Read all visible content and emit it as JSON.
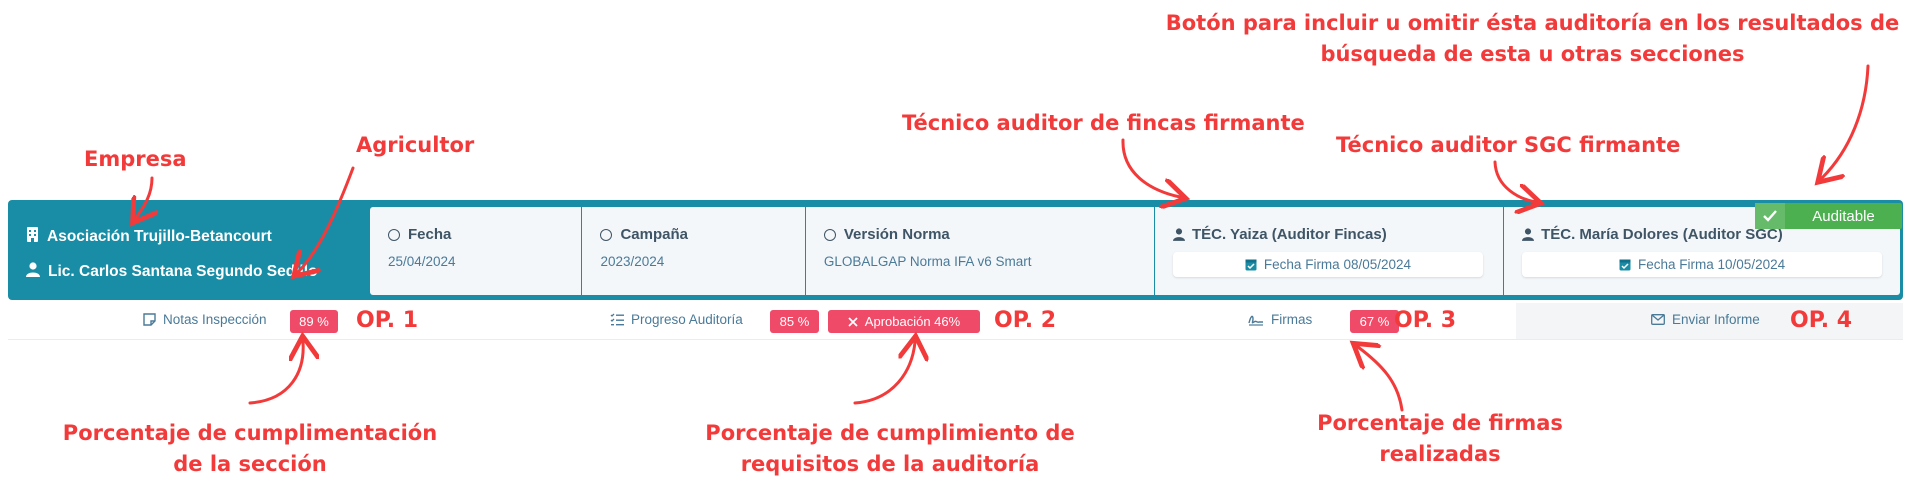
{
  "annotations": {
    "empresa": "Empresa",
    "agricultor": "Agricultor",
    "tecnico_fincas": "Técnico auditor de fincas firmante",
    "tecnico_sgc": "Técnico auditor SGC firmante",
    "boton_line1": "Botón para incluir u omitir ésta auditoría en los resultados de",
    "boton_line2": "búsqueda de esta u otras secciones",
    "seccion_line1": "Porcentaje de cumplimentación",
    "seccion_line2": "de la sección",
    "requisitos_line1": "Porcentaje de cumplimiento de",
    "requisitos_line2": "requisitos de la auditoría",
    "firmas_line1": "Porcentaje de firmas",
    "firmas_line2": "realizadas",
    "op1": "OP. 1",
    "op2": "OP. 2",
    "op3": "OP. 3",
    "op4": "OP. 4"
  },
  "card": {
    "company": "Asociación Trujillo-Betancourt",
    "farmer": "Lic. Carlos Santana Segundo Sedillo",
    "fecha_label": "Fecha",
    "fecha_value": "25/04/2024",
    "campana_label": "Campaña",
    "campana_value": "2023/2024",
    "norma_label": "Versión Norma",
    "norma_value": "GLOBALGAP Norma IFA v6 Smart",
    "auditor_fincas": "TÉC. Yaiza (Auditor Fincas)",
    "auditor_fincas_fecha": "Fecha Firma 08/05/2024",
    "auditor_sgc": "TÉC. María Dolores (Auditor SGC)",
    "auditor_sgc_fecha": "Fecha Firma 10/05/2024",
    "toggle_label": "Auditable"
  },
  "footer": {
    "notas_label": "Notas Inspección",
    "notas_pct": "89 %",
    "progreso_label": "Progreso Auditoría",
    "progreso_pct": "85 %",
    "aprobacion": "Aprobación 46%",
    "firmas_label": "Firmas",
    "firmas_pct": "67 %",
    "enviar_label": "Enviar Informe"
  },
  "colors": {
    "annotation": "#f23a3a",
    "card_teal": "#1a8da6",
    "badge_pink": "#ef4a68",
    "toggle_green": "#4caf50"
  }
}
